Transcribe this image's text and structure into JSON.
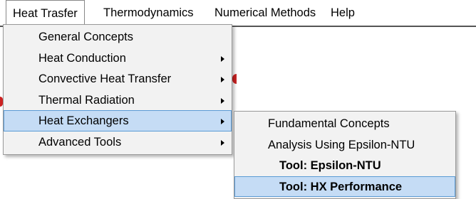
{
  "menubar": {
    "items": [
      {
        "label": "Heat Trasfer",
        "open": true
      },
      {
        "label": "Thermodynamics"
      },
      {
        "label": "Numerical Methods"
      },
      {
        "label": "Help"
      }
    ]
  },
  "heat_transfer_menu": {
    "items": [
      {
        "label": "General Concepts",
        "has_submenu": false
      },
      {
        "label": "Heat Conduction",
        "has_submenu": true
      },
      {
        "label": "Convective Heat Transfer",
        "has_submenu": true
      },
      {
        "label": "Thermal Radiation",
        "has_submenu": true
      },
      {
        "label": "Heat Exchangers",
        "has_submenu": true,
        "highlighted": true
      },
      {
        "label": "Advanced Tools",
        "has_submenu": true
      }
    ]
  },
  "heat_exchangers_submenu": {
    "items": [
      {
        "label": "Fundamental Concepts"
      },
      {
        "label": "Analysis Using Epsilon-NTU"
      },
      {
        "label": "Tool: Epsilon-NTU",
        "bold": true
      },
      {
        "label": "Tool: HX Performance",
        "bold": true,
        "highlighted": true
      }
    ]
  },
  "icons": {
    "submenu_indicator": "chevron-right-icon"
  },
  "colors": {
    "highlight_fill": "#c5dcf5",
    "highlight_border": "#5b9bd5",
    "menu_background": "#f2f2f2"
  }
}
